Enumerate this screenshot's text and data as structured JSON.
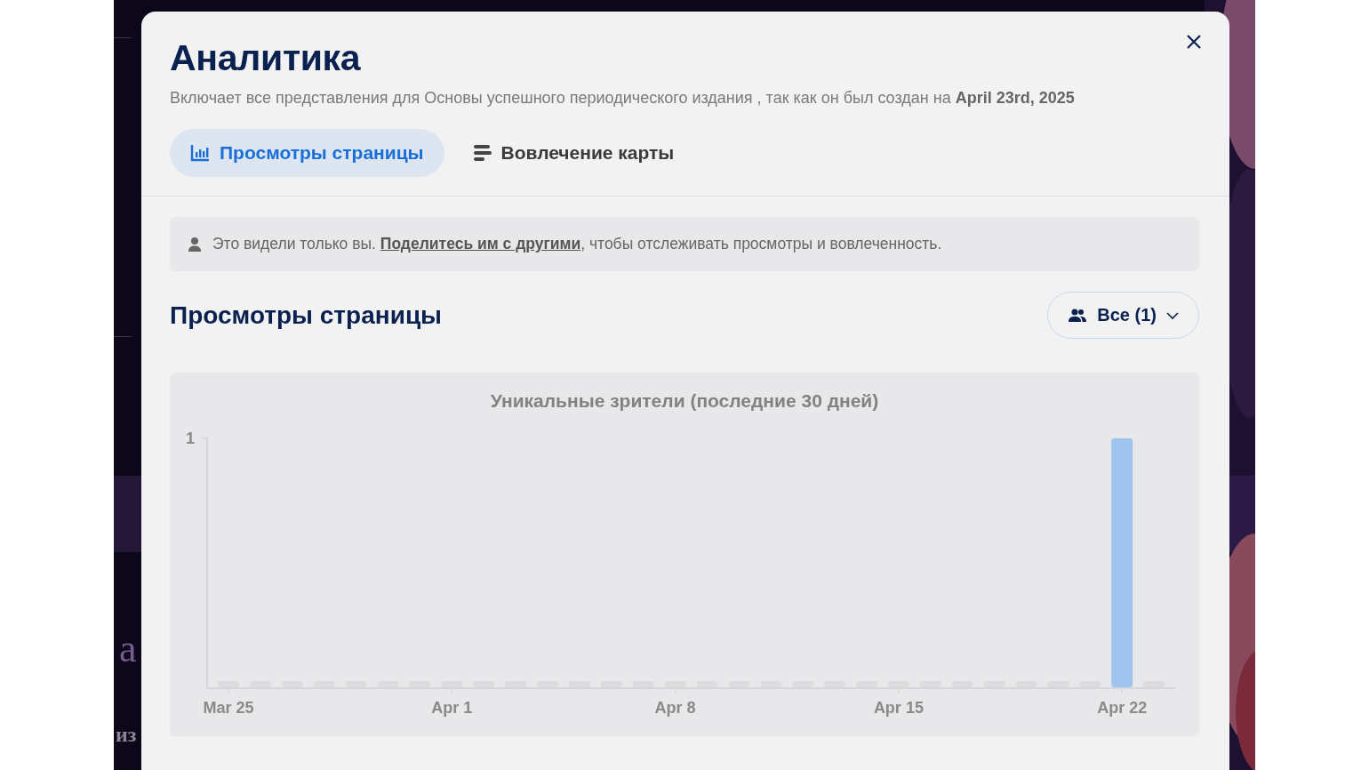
{
  "background_page": {
    "texts": [
      "а",
      "из"
    ]
  },
  "dialog": {
    "title": "Аналитика",
    "subtitle": "Включает все представления для Основы успешного периодического издания , так как он был создан на **April 23rd, 2025**",
    "tabs": [
      {
        "label": "Просмотры страницы",
        "kind": "bar-chart",
        "selected": true
      },
      {
        "label": "Вовлечение карты",
        "kind": "list",
        "selected": false
      }
    ],
    "notice": {
      "before": "Это видели только вы. ",
      "link": "Поделитесь им с другими",
      "after": ", чтобы отслеживать просмотры и вовлеченность."
    },
    "section": {
      "heading": "Просмотры страницы",
      "filter": {
        "label": "Все (1)"
      }
    },
    "chart": {
      "title": "Уникальные зрители (последние 30 дней)",
      "y_axis_label": "1",
      "x_axis_labels": [
        "Mar 25",
        "Apr 1",
        "Apr 8",
        "Apr 15",
        "Apr 22"
      ]
    }
  }
}
